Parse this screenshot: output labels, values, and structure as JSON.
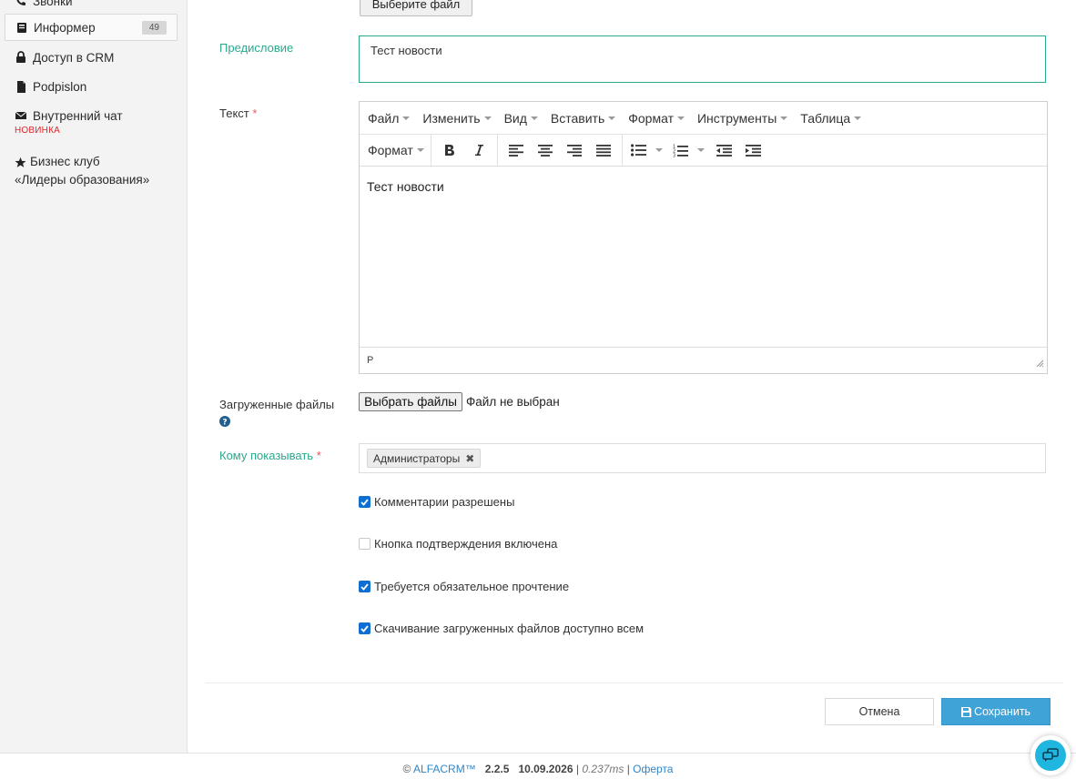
{
  "sidebar": {
    "items": [
      {
        "label": "Звонки",
        "icon": "phone-icon"
      },
      {
        "label": "Информер",
        "icon": "book-icon",
        "badge": "49",
        "active": true
      },
      {
        "label": "Доступ в CRM",
        "icon": "lock-icon"
      },
      {
        "label": "Podpislon",
        "icon": "file-icon"
      },
      {
        "label": "Внутренний чат",
        "icon": "envelope-icon",
        "tag": "НОВИНКА"
      },
      {
        "label_line1": "Бизнес клуб",
        "label_line2": "«Лидеры образования»",
        "icon": "star-icon"
      }
    ]
  },
  "form": {
    "top_file_button": "Выберите файл",
    "preface": {
      "label": "Предисловие",
      "value": "Тест новости"
    },
    "text": {
      "label": "Текст",
      "required_mark": "*",
      "menu": [
        "Файл",
        "Изменить",
        "Вид",
        "Вставить",
        "Формат",
        "Инструменты",
        "Таблица"
      ],
      "toolbar_format": "Формат",
      "content": "Тест новости",
      "status_path": "P"
    },
    "uploaded_files": {
      "label": "Загруженные файлы",
      "button": "Выбрать файлы",
      "status": "Файл не выбран"
    },
    "show_to": {
      "label": "Кому показывать",
      "required_mark": "*",
      "selected": [
        "Администраторы"
      ]
    },
    "checkboxes": [
      {
        "label": "Комментарии разрешены",
        "checked": true
      },
      {
        "label": "Кнопка подтверждения включена",
        "checked": false
      },
      {
        "label": "Требуется обязательное прочтение",
        "checked": true
      },
      {
        "label": "Скачивание загруженных файлов доступно всем",
        "checked": true
      }
    ],
    "cancel_label": "Отмена",
    "save_label": "Сохранить"
  },
  "footer": {
    "copyright": "©",
    "brand": "ALFACRM™",
    "version": "2.2.5",
    "date": "10.09.2026",
    "sep1": "|",
    "timing": "0.237ms",
    "sep2": "|",
    "offer": "Оферта"
  },
  "colors": {
    "accent_teal": "#2ba98d",
    "primary_blue": "#3fa3d8",
    "checkbox_blue": "#0f6fd0",
    "new_red": "#e0282d",
    "fab_cyan": "#1fb7df"
  }
}
